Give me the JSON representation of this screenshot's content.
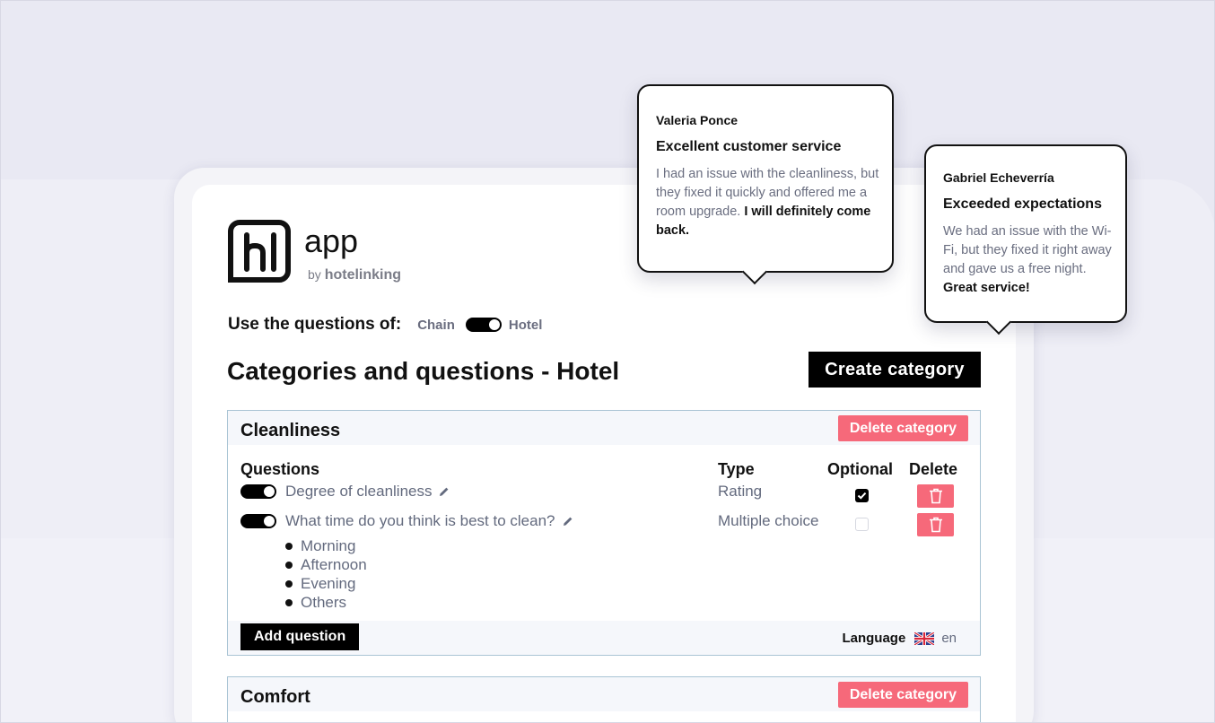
{
  "logo": {
    "app_label": "app",
    "by_label": "by",
    "brand": "hotelinking",
    "mark_icon": "hl-logo-icon"
  },
  "source_toggle": {
    "label": "Use the questions of:",
    "left_option": "Chain",
    "right_option": "Hotel",
    "selected": "Hotel"
  },
  "page": {
    "title": "Categories and questions - Hotel",
    "create_category_label": "Create category"
  },
  "categories": [
    {
      "title": "Cleanliness",
      "delete_label": "Delete category",
      "columns": {
        "questions": "Questions",
        "type": "Type",
        "optional": "Optional",
        "delete": "Delete"
      },
      "questions": [
        {
          "text": "Degree of cleanliness",
          "type": "Rating",
          "enabled": true,
          "optional": true
        },
        {
          "text": "What time do you think is best to clean?",
          "type": "Multiple choice",
          "enabled": true,
          "optional": false,
          "options": [
            "Morning",
            "Afternoon",
            "Evening",
            "Others"
          ]
        }
      ],
      "add_question_label": "Add question",
      "language_label": "Language",
      "language_code": "en",
      "language_flag_icon": "uk-flag-icon"
    },
    {
      "title": "Comfort",
      "delete_label": "Delete category"
    }
  ],
  "reviews": [
    {
      "author": "Valeria Ponce",
      "title": "Excellent customer service",
      "body": "I had an issue with the cleanliness, but they fixed it quickly and offered me a room upgrade.",
      "highlight": "I will definitely come back."
    },
    {
      "author": "Gabriel Echeverría",
      "title": "Exceeded expectations",
      "body": "We had an issue with the Wi-Fi, but they fixed it right away and gave us a free night.",
      "highlight": "Great service!"
    }
  ],
  "colors": {
    "background": "#e9e9f3",
    "accent_black": "#000000",
    "danger": "#f6697a",
    "card_border": "#a9c4d4",
    "muted_text": "#636a7e"
  }
}
